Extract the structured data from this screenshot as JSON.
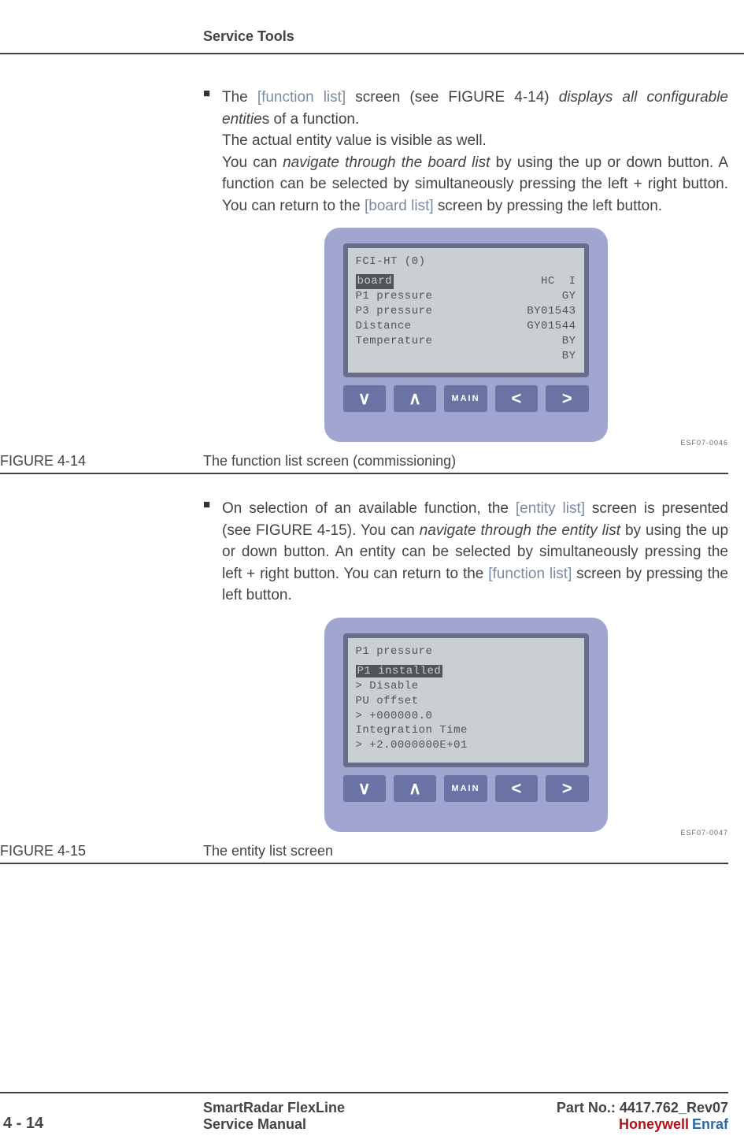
{
  "header": {
    "section": "Service Tools"
  },
  "body": {
    "p1": {
      "pre": "The ",
      "link1": "[function list]",
      "mid1": " screen (see FIGURE 4-14) ",
      "ital1": "displays all configurable entitie",
      "post1": "s of a function."
    },
    "p1b": "The actual entity value is visible as well.",
    "p1c": {
      "pre": "You can ",
      "ital": "navigate through the board list",
      "mid": " by using the up or down button. A function can be selected by simultaneously pressing the left + right button. You can return to the ",
      "link": "[board list]",
      "post": " screen by pressing the left button."
    },
    "p2": {
      "pre": "On selection of an available function, the ",
      "link1": "[entity list]",
      "mid1": " screen is presented (see FIGURE 4-15). You can ",
      "ital1": "navigate through the entity list",
      "mid2": " by using the up or down button. An entity can be selected by simultaneously pressing the left + right button. You can return to the ",
      "link2": "[function list]",
      "post": " screen by pressing the left button."
    }
  },
  "fig414": {
    "label": "FIGURE  4-14",
    "caption": "The function list screen (commissioning)",
    "code": "ESF07-0046",
    "screen": {
      "title": "FCI-HT (0)",
      "rows": [
        {
          "l": "board",
          "r": "HC  I",
          "sel": true
        },
        {
          "l": "P1 pressure",
          "r": "GY"
        },
        {
          "l": "P3 pressure",
          "r": "BY01543"
        },
        {
          "l": "Distance",
          "r": "GY01544"
        },
        {
          "l": "Temperature",
          "r": "BY"
        },
        {
          "l": "",
          "r": "BY"
        }
      ]
    }
  },
  "fig415": {
    "label": "FIGURE  4-15",
    "caption": "The entity list screen",
    "code": "ESF07-0047",
    "screen": {
      "title": "P1 pressure",
      "lines": [
        {
          "t": "P1 installed",
          "sel": true
        },
        {
          "t": "> Disable"
        },
        {
          "t": "PU offset"
        },
        {
          "t": "> +000000.0"
        },
        {
          "t": "Integration Time"
        },
        {
          "t": "> +2.0000000E+01"
        }
      ]
    }
  },
  "keys": {
    "down": "∨",
    "up": "∧",
    "main": "MAIN",
    "left": "<",
    "right": ">"
  },
  "footer": {
    "page": "4 - 14",
    "title1": "SmartRadar FlexLine",
    "title2": "Service Manual",
    "part": "Part No.: 4417.762_Rev07",
    "brand_a": "Honeywell",
    "brand_b": "Enraf"
  }
}
